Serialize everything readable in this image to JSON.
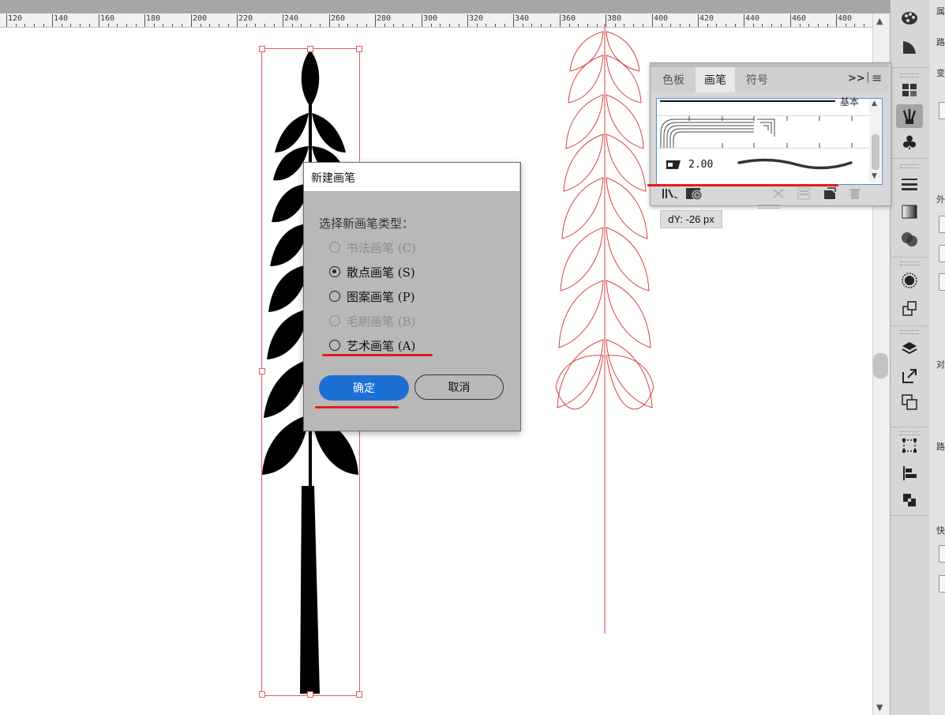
{
  "ruler": {
    "labels": [
      "120",
      "140",
      "160",
      "180",
      "200",
      "220",
      "240",
      "260",
      "280",
      "300",
      "320",
      "340",
      "360",
      "380",
      "400",
      "420",
      "440",
      "460",
      "480"
    ]
  },
  "brushes_panel": {
    "tabs": [
      {
        "label": "色板",
        "active": false
      },
      {
        "label": "画笔",
        "active": true
      },
      {
        "label": "符号",
        "active": false
      }
    ],
    "menu_glyph": "≡",
    "overflow_glyph": ">>",
    "basic_brush_label": "基本",
    "selected_brush_size": "2.00"
  },
  "tooltip": {
    "text": "dY: -26 px"
  },
  "dialog": {
    "title": "新建画笔",
    "prompt": "选择新画笔类型：",
    "options": [
      {
        "label": "书法画笔 (C)",
        "enabled": false,
        "selected": false
      },
      {
        "label": "散点画笔 (S)",
        "enabled": true,
        "selected": true
      },
      {
        "label": "图案画笔 (P)",
        "enabled": true,
        "selected": false
      },
      {
        "label": "毛刷画笔 (B)",
        "enabled": false,
        "selected": false
      },
      {
        "label": "艺术画笔 (A)",
        "enabled": true,
        "selected": false
      }
    ],
    "ok_label": "确定",
    "cancel_label": "取消"
  },
  "right_strip": {
    "labels": [
      "属",
      "路",
      "变",
      "外",
      "对",
      "路",
      "快"
    ]
  },
  "colors": {
    "accent": "#1c6fd3",
    "annotation_red": "#e01e1e",
    "guide_red": "#d94040"
  }
}
